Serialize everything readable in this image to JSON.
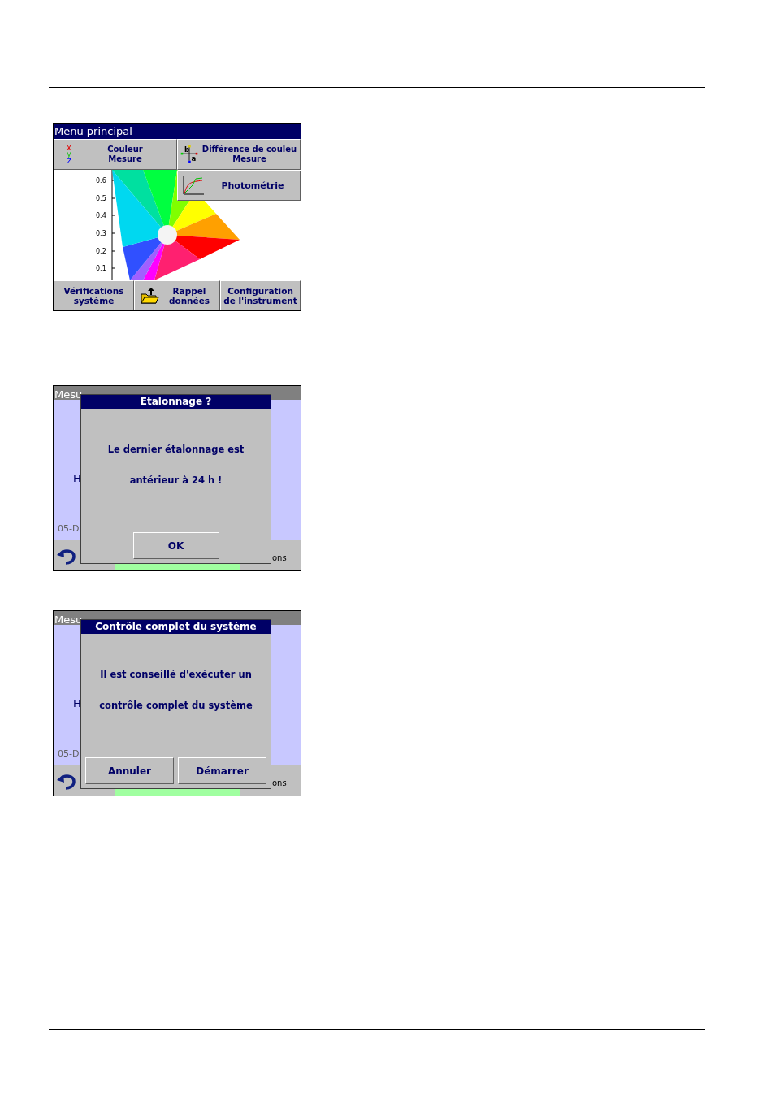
{
  "main_menu": {
    "title": "Menu principal",
    "top_buttons": [
      {
        "kind": "xyz",
        "label": "Couleur",
        "sublabel": "Mesure",
        "icon_letters": [
          "x",
          "y",
          "z"
        ]
      },
      {
        "kind": "axes",
        "label": "Différence de couleu",
        "sublabel": "Mesure",
        "icon_letters": [
          "b",
          "a"
        ]
      }
    ],
    "side_button": {
      "label": "Photométrie"
    },
    "y_ticks": [
      "0.6",
      "0.5",
      "0.4",
      "0.3",
      "0.2",
      "0.1"
    ],
    "bottom_buttons": [
      {
        "kind": "text",
        "lines": [
          "Vérifications",
          "système"
        ]
      },
      {
        "kind": "folder",
        "lines": [
          "Rappel",
          "données"
        ]
      },
      {
        "kind": "text",
        "lines": [
          "Configuration",
          "de l'instrument"
        ]
      }
    ]
  },
  "dialogs": [
    {
      "screen_title": "Mesu",
      "body_letter": "H",
      "body_date": "05-D",
      "bottom_right": "ons",
      "title": "Etalonnage ?",
      "lines": [
        "Le dernier étalonnage est",
        "antérieur à 24 h !"
      ],
      "buttons": [
        "OK"
      ]
    },
    {
      "screen_title": "Mesu",
      "body_letter": "H",
      "body_date": "05-D",
      "bottom_right": "ons",
      "title": "Contrôle complet du système",
      "lines": [
        "Il est conseillé d'exécuter un",
        "contrôle complet du système"
      ],
      "buttons": [
        "Annuler",
        "Démarrer"
      ]
    }
  ]
}
